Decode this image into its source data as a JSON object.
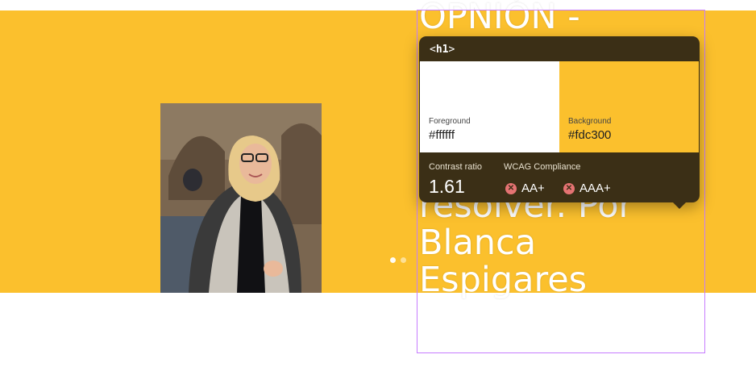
{
  "headline": {
    "top_text": "OPNIÓN -",
    "lines": [
      "resolver. Por",
      "Blanca",
      "Espigares"
    ]
  },
  "photo": {
    "icon": "portrait-photo"
  },
  "carousel": {
    "dots": 2,
    "active": 0
  },
  "inspector": {
    "tag": "h1",
    "foreground_label": "Foreground",
    "foreground_value": "#ffffff",
    "background_label": "Background",
    "background_value": "#fdc300",
    "contrast_label": "Contrast ratio",
    "contrast_value": "1.61",
    "wcag_label": "WCAG Compliance",
    "aa_label": "AA+",
    "aaa_label": "AAA+",
    "fail_icon": "x-circle-icon"
  },
  "colors": {
    "banner": "#fbc02d",
    "outline": "#c77dff",
    "tooltip": "#3b2f16",
    "fail": "#e57373"
  }
}
